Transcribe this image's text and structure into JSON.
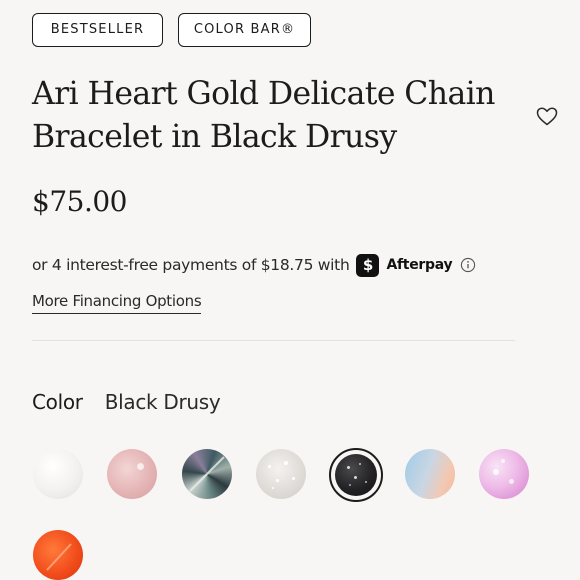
{
  "badges": {
    "bestseller": "BESTSELLER",
    "color_bar": "COLOR BAR®"
  },
  "product": {
    "title_line1": "Ari Heart Gold Delicate Chain",
    "title_line2": "Bracelet in Black Drusy",
    "price": "$75.00"
  },
  "financing": {
    "installments_text": "or 4 interest-free payments of $18.75 with",
    "provider_mark": "$",
    "provider": "Afterpay",
    "more_options_link": "More Financing Options"
  },
  "color": {
    "label": "Color",
    "selected": "Black Drusy"
  },
  "icons": {
    "wishlist": "heart-outline-icon",
    "info": "info-circle-icon"
  },
  "colors": {
    "text": "#1c1c1c",
    "background": "#f8f6f4",
    "badge_border": "#1c1c1c",
    "divider": "#e4e0dc"
  }
}
